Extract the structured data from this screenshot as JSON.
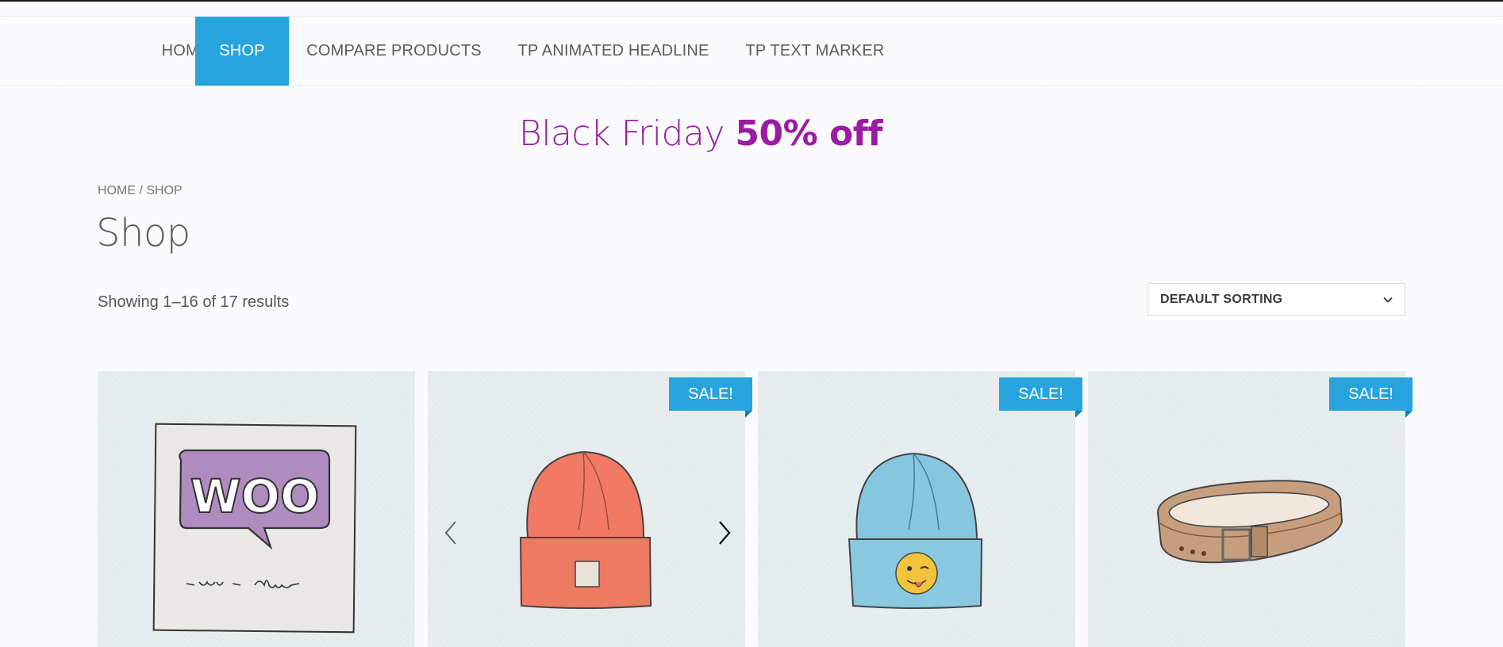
{
  "nav": {
    "items": [
      {
        "label": "HOME"
      },
      {
        "label": "SHOP"
      },
      {
        "label": "COMPARE PRODUCTS"
      },
      {
        "label": "TP ANIMATED HEADLINE"
      },
      {
        "label": "TP TEXT MARKER"
      }
    ],
    "active": "SHOP"
  },
  "promo": {
    "text": "Black Friday",
    "highlight": "50% off",
    "color": "#9b1ba3"
  },
  "breadcrumb": {
    "home": "HOME",
    "separator": " / ",
    "current": "SHOP"
  },
  "page": {
    "title": "Shop",
    "result_count": "Showing 1–16 of 17 results"
  },
  "sort": {
    "selected": "DEFAULT SORTING",
    "icon": "chevron-down-icon"
  },
  "products": [
    {
      "image": "woo-album-cover",
      "sale": false,
      "sale_label": ""
    },
    {
      "image": "orange-beanie",
      "sale": true,
      "sale_label": "SALE!"
    },
    {
      "image": "blue-beanie-with-emoji-patch",
      "sale": true,
      "sale_label": "SALE!"
    },
    {
      "image": "brown-leather-belt",
      "sale": true,
      "sale_label": "SALE!"
    }
  ],
  "gallery": {
    "prev_icon": "chevron-left-icon",
    "next_icon": "chevron-right-icon"
  },
  "colors": {
    "accent": "#27a3dd",
    "promo": "#9b1ba3"
  }
}
